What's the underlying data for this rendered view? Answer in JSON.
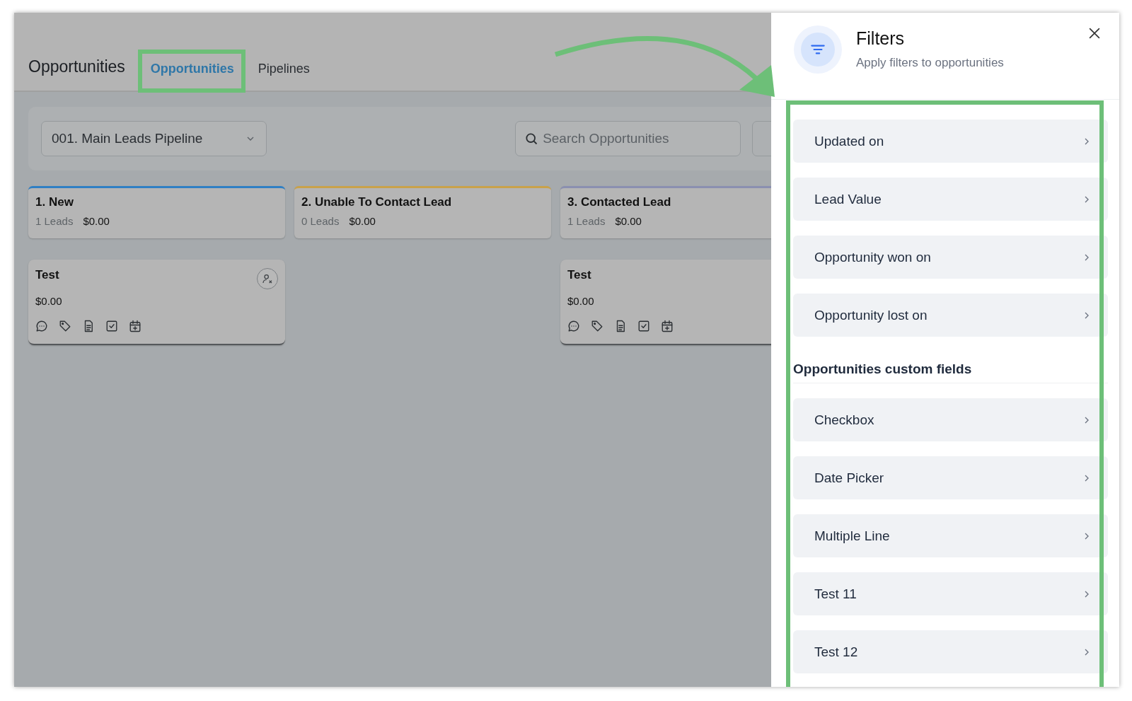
{
  "header": {
    "title": "Opportunities",
    "tabs": [
      {
        "label": "Opportunities",
        "selected": true
      },
      {
        "label": "Pipelines",
        "selected": false
      }
    ]
  },
  "toolbar": {
    "pipeline": "001. Main Leads Pipeline",
    "search": {
      "placeholder": "Search Opportunities"
    }
  },
  "stages": [
    {
      "name": "1. New",
      "count": "1 Leads",
      "amount": "$0.00",
      "color": "#2f7fc4",
      "cards": [
        {
          "title": "Test",
          "amount": "$0.00",
          "assign_icon": true
        }
      ]
    },
    {
      "name": "2. Unable To Contact Lead",
      "count": "0 Leads",
      "amount": "$0.00",
      "color": "#c9a24a"
    },
    {
      "name": "3. Contacted Lead",
      "count": "1 Leads",
      "amount": "$0.00",
      "color": "#8a8fb0",
      "cards": [
        {
          "title": "Test",
          "amount": "$0.00"
        }
      ]
    }
  ],
  "filters": {
    "title": "Filters",
    "subtitle": "Apply filters to opportunities",
    "items": [
      {
        "kind": "row",
        "label": "Updated on"
      },
      {
        "kind": "row",
        "label": "Lead Value"
      },
      {
        "kind": "row",
        "label": "Opportunity won on"
      },
      {
        "kind": "row",
        "label": "Opportunity lost on"
      },
      {
        "kind": "section",
        "label": "Opportunities custom fields"
      },
      {
        "kind": "row",
        "label": "Checkbox"
      },
      {
        "kind": "row",
        "label": "Date Picker"
      },
      {
        "kind": "row",
        "label": "Multiple Line"
      },
      {
        "kind": "row",
        "label": "Test 11"
      },
      {
        "kind": "row",
        "label": "Test 12"
      }
    ]
  }
}
